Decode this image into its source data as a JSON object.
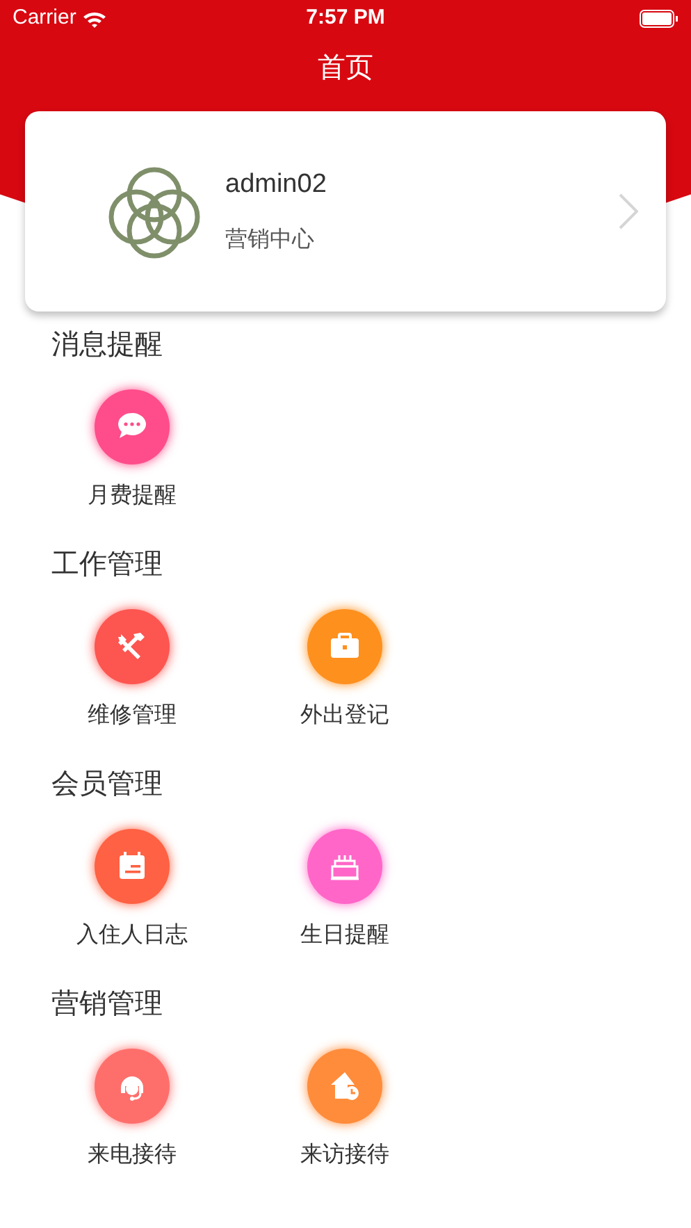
{
  "status_bar": {
    "carrier": "Carrier",
    "time": "7:57 PM"
  },
  "title": "首页",
  "profile": {
    "name": "admin02",
    "department": "营销中心"
  },
  "sections": [
    {
      "title": "消息提醒",
      "items": [
        {
          "label": "月费提醒",
          "kind": "chat",
          "color": "#fe4d8a"
        }
      ]
    },
    {
      "title": "工作管理",
      "items": [
        {
          "label": "维修管理",
          "kind": "tools",
          "color": "#fd5550"
        },
        {
          "label": "外出登记",
          "kind": "briefcase",
          "color": "#fe901e"
        }
      ]
    },
    {
      "title": "会员管理",
      "items": [
        {
          "label": "入住人日志",
          "kind": "calendar",
          "color": "#fe6143"
        },
        {
          "label": "生日提醒",
          "kind": "cake",
          "color": "#ff66c8"
        }
      ]
    },
    {
      "title": "营销管理",
      "items": [
        {
          "label": "来电接待",
          "kind": "headset",
          "color": "#fe6f6c"
        },
        {
          "label": "来访接待",
          "kind": "house",
          "color": "#fe8c3b"
        }
      ]
    }
  ]
}
